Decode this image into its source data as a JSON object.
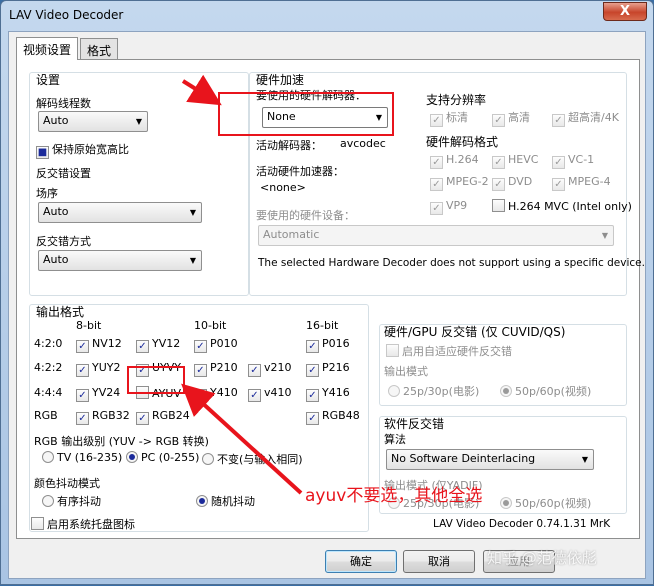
{
  "window": {
    "title": "LAV Video Decoder",
    "close": "X"
  },
  "tabs": [
    {
      "label": "视频设置"
    },
    {
      "label": "格式"
    }
  ],
  "settings": {
    "title": "设置",
    "threads_label": "解码线程数",
    "threads_value": "Auto",
    "keep_aspect": "保持原始宽高比",
    "deint_settings": "反交错设置",
    "field_order_label": "场序",
    "field_order_value": "Auto",
    "deint_mode_label": "反交错方式",
    "deint_mode_value": "Auto"
  },
  "hwaccel": {
    "title": "硬件加速",
    "decoder_label": "要使用的硬件解码器：",
    "decoder_value": "None",
    "active_decoder_label": "活动解码器：",
    "active_decoder_value": "avcodec",
    "active_accel_label": "活动硬件加速器：",
    "active_accel_value": "<none>",
    "device_label": "要使用的硬件设备：",
    "device_value": "Automatic",
    "message": "The selected Hardware Decoder does not support using a specific device.",
    "resolution_title": "支持分辨率",
    "resolutions": [
      "标清",
      "高清",
      "超高清/4K"
    ],
    "codecs_title": "硬件解码格式",
    "codecs": [
      "H.264",
      "HEVC",
      "VC-1",
      "MPEG-2",
      "DVD",
      "MPEG-4",
      "VP9",
      "H.264 MVC (Intel only)"
    ]
  },
  "output": {
    "title": "输出格式",
    "headers": [
      "8-bit",
      "10-bit",
      "16-bit"
    ],
    "rows": [
      {
        "label": "4:2:0",
        "formats": [
          "NV12",
          "YV12",
          "P010",
          "P016"
        ]
      },
      {
        "label": "4:2:2",
        "formats": [
          "YUY2",
          "UYVY",
          "P210",
          "v210",
          "P216"
        ]
      },
      {
        "label": "4:4:4",
        "formats": [
          "YV24",
          "AYUV",
          "Y410",
          "v410",
          "Y416"
        ]
      },
      {
        "label": "RGB",
        "formats": [
          "RGB32",
          "RGB24",
          "RGB48"
        ]
      }
    ],
    "rgb_levels_label": "RGB 输出级别 (YUV -> RGB 转换)",
    "rgb_levels": [
      "TV (16-235)",
      "PC (0-255)",
      "不变(与输入相同)"
    ],
    "dither_label": "颜色抖动模式",
    "dither_modes": [
      "有序抖动",
      "随机抖动"
    ]
  },
  "hw_deint": {
    "title": "硬件/GPU 反交错 (仅 CUVID/QS)",
    "adaptive": "启用自适应硬件反交错",
    "output_mode": "输出模式",
    "modes": [
      "25p/30p(电影)",
      "50p/60p(视频)"
    ]
  },
  "sw_deint": {
    "title": "软件反交错",
    "algorithm_label": "算法",
    "algorithm_value": "No Software Deinterlacing",
    "output_mode": "输出模式 (仅YADIF)",
    "modes": [
      "25p/30p(电影)",
      "50p/60p(视频)"
    ]
  },
  "footer": {
    "tray_icon": "启用系统托盘图标",
    "version": "LAV Video Decoder 0.74.1.31 MrK",
    "ok": "确定",
    "cancel": "取消",
    "apply": "应用"
  },
  "overlay": {
    "annotation": "ayuv不要选，其他全选",
    "watermark": "知乎 @范德依彪",
    "accent_color": "#e8141c"
  }
}
